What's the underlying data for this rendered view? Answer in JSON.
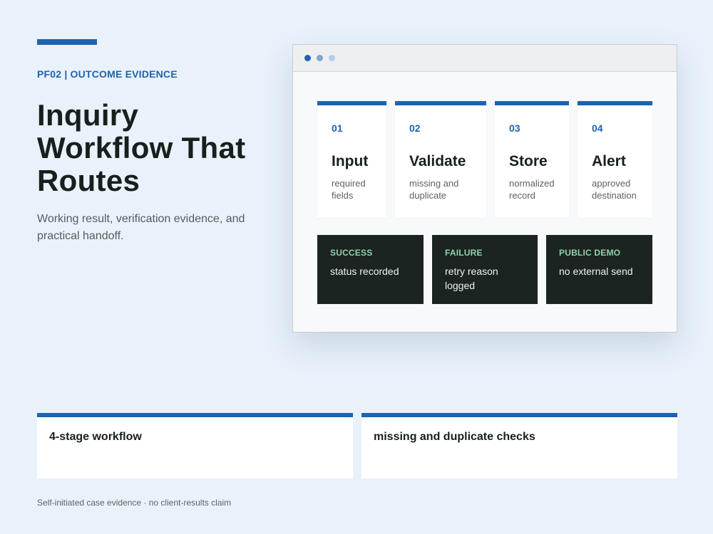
{
  "eyebrow": "PF02 | OUTCOME EVIDENCE",
  "title": "Inquiry Workflow That Routes",
  "subtitle": "Working result, verification evidence, and practical handoff.",
  "window": {
    "dots": [
      "active-dot",
      "mid-dot",
      "light-dot"
    ],
    "stages": [
      {
        "number": "01",
        "name": "Input",
        "description": "required fields"
      },
      {
        "number": "02",
        "name": "Validate",
        "description": "missing and duplicate"
      },
      {
        "number": "03",
        "name": "Store",
        "description": "normalized record"
      },
      {
        "number": "04",
        "name": "Alert",
        "description": "approved destination"
      }
    ],
    "statuses": [
      {
        "label": "SUCCESS",
        "text": "status recorded"
      },
      {
        "label": "FAILURE",
        "text": "retry reason logged"
      },
      {
        "label": "PUBLIC DEMO",
        "text": "no external send"
      }
    ]
  },
  "bottom_cards": [
    {
      "text": "4-stage workflow"
    },
    {
      "text": "missing and duplicate checks"
    }
  ],
  "footnote": "Self-initiated case evidence · no client-results claim",
  "colors": {
    "accent": "#1f63ad",
    "background": "#e9f1fb",
    "dark_panel": "#1b2421",
    "status_label": "#8fd1ae"
  }
}
